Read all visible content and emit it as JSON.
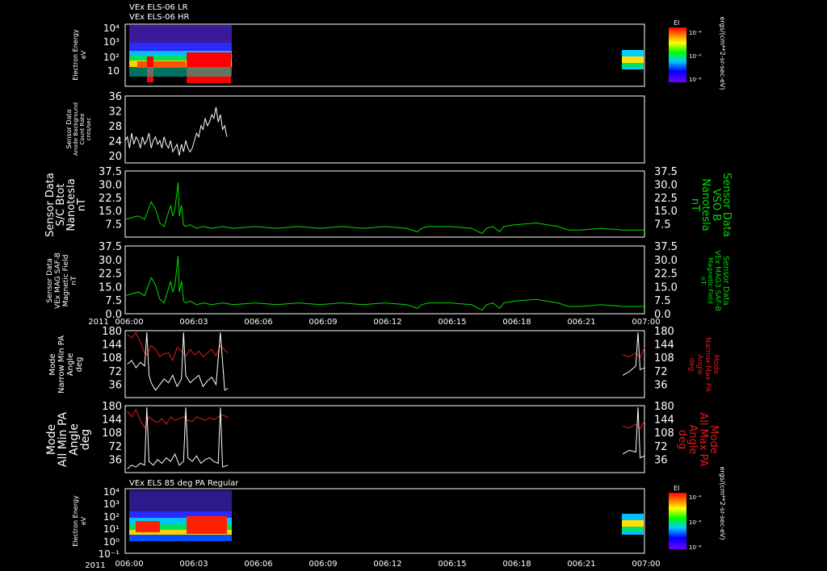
{
  "titles": {
    "top_line1": "VEx ELS-06 LR",
    "top_line2": "VEx ELS-06 HR",
    "bottom": "VEx ELS 85 deg PA Regular"
  },
  "time_axis": {
    "year_label": "2011",
    "ticks": [
      "006:00",
      "006:03",
      "006:06",
      "006:09",
      "006:12",
      "006:15",
      "006:18",
      "006:21",
      "007:00"
    ]
  },
  "colorbars": {
    "top": {
      "label": "EI",
      "ticks": [
        "10⁻⁴",
        "10⁻⁶",
        "10⁻⁸"
      ],
      "side_label": "ergs/(cm**2-sr-sec-eV)"
    },
    "bottom": {
      "label": "EI",
      "ticks": [
        "10⁻⁴",
        "10⁻⁶",
        "10⁻⁸"
      ],
      "side_label": "ergs/(cm**2-sr-sec-eV)"
    }
  },
  "colors": {
    "green": "#00dd00",
    "red": "#e41a1a",
    "white": "#ffffff"
  },
  "chart_data": [
    {
      "type": "heatmap",
      "ylabel": [
        "Electron Energy",
        "eV"
      ],
      "y_tick_labels": [
        "10⁴",
        "10³",
        "10²",
        "10"
      ],
      "log_scale": true
    },
    {
      "type": "line",
      "ylabel": [
        "Sensor Data",
        "Anode Background",
        "Count Rate",
        "cnts/sec"
      ],
      "ylim": [
        18,
        36
      ],
      "y_tick_labels": [
        "36",
        "32",
        "28",
        "24",
        "20"
      ],
      "series": [
        {
          "color": "white",
          "x": [
            0,
            0.1,
            0.2,
            0.3,
            0.4,
            0.5,
            0.6,
            0.7,
            0.8,
            0.9,
            1.0,
            1.1,
            1.2,
            1.3,
            1.4,
            1.5,
            1.6,
            1.7,
            1.8,
            1.9,
            2.0,
            2.1,
            2.2,
            2.3,
            2.4,
            2.5,
            2.6,
            2.7,
            2.8,
            2.9,
            3.0,
            3.1,
            3.2,
            3.3,
            3.4,
            3.5,
            3.6,
            3.7,
            3.8,
            3.9,
            4.0,
            4.1,
            4.2,
            4.3,
            4.4,
            4.5,
            4.6,
            4.7
          ],
          "values": [
            24,
            25,
            22,
            26,
            23,
            25,
            24,
            22,
            25,
            23,
            24,
            26,
            22,
            24,
            25,
            23,
            24,
            22,
            25,
            23,
            22,
            24,
            21,
            22,
            23,
            20,
            23,
            21,
            24,
            22,
            21,
            22,
            24,
            26,
            25,
            28,
            27,
            30,
            28,
            29,
            31,
            30,
            33,
            29,
            31,
            27,
            28,
            25
          ]
        }
      ]
    },
    {
      "type": "line",
      "ylabel": [
        "Sensor Data",
        "S/C Btot",
        "Nanotesla",
        "nT"
      ],
      "right_label": [
        "Sensor Data",
        "VSO B",
        "Nanotesla",
        "nT"
      ],
      "ylim": [
        0,
        37.5
      ],
      "y_tick_labels": [
        "37.5",
        "30.0",
        "22.5",
        "15.0",
        "7.5"
      ],
      "series": [
        {
          "color": "green",
          "x": [
            0,
            0.3,
            0.6,
            0.9,
            1.2,
            1.4,
            1.6,
            1.8,
            2.0,
            2.1,
            2.2,
            2.3,
            2.45,
            2.5,
            2.6,
            2.7,
            2.8,
            3.0,
            3.3,
            3.6,
            4.0,
            4.5,
            5,
            6,
            7,
            8,
            9,
            10,
            11,
            12,
            13,
            13.5,
            13.7,
            14,
            15,
            16,
            16.5,
            16.7,
            17,
            17.3,
            17.5,
            18,
            19,
            20,
            20.5,
            21,
            22,
            23,
            24
          ],
          "values": [
            10,
            11,
            12,
            10,
            20,
            16,
            8,
            6,
            14,
            18,
            12,
            16,
            31,
            12,
            18,
            7,
            6,
            7,
            5,
            6,
            5,
            6,
            5,
            6,
            5,
            6,
            5,
            6,
            5,
            6,
            5,
            3,
            5,
            6,
            6,
            5,
            2,
            5,
            6,
            3,
            6,
            7,
            8,
            6,
            4,
            4,
            5,
            4,
            4
          ]
        }
      ]
    },
    {
      "type": "line",
      "ylabel": [
        "Sensor Data",
        "VEx MAG SAF-B",
        "Magnetic Field",
        "nT"
      ],
      "right_label": [
        "Sensor Data",
        "VEx MAG3 SAF-B",
        "Magnetic Field",
        "nT"
      ],
      "ylim": [
        0,
        37.5
      ],
      "y_tick_labels": [
        "37.5",
        "30.0",
        "22.5",
        "15.0",
        "7.5",
        "0.0"
      ],
      "series": [
        {
          "color": "green",
          "x": [
            0,
            0.3,
            0.6,
            0.9,
            1.2,
            1.4,
            1.6,
            1.8,
            2.0,
            2.1,
            2.2,
            2.3,
            2.45,
            2.5,
            2.6,
            2.7,
            2.8,
            3.0,
            3.3,
            3.6,
            4.0,
            4.5,
            5,
            6,
            7,
            8,
            9,
            10,
            11,
            12,
            13,
            13.5,
            13.7,
            14,
            15,
            16,
            16.5,
            16.7,
            17,
            17.3,
            17.5,
            18,
            19,
            20,
            20.5,
            21,
            22,
            23,
            24
          ],
          "values": [
            10,
            11,
            12,
            10,
            20,
            16,
            8,
            6,
            14,
            18,
            12,
            16,
            32,
            12,
            18,
            7,
            6,
            7,
            5,
            6,
            5,
            6,
            5,
            6,
            5,
            6,
            5,
            6,
            5,
            6,
            5,
            3,
            5,
            6,
            6,
            5,
            2,
            5,
            6,
            3,
            6,
            7,
            8,
            6,
            4,
            4,
            5,
            4,
            4
          ]
        }
      ]
    },
    {
      "type": "line",
      "ylabel": [
        "Mode",
        "Narrow Min PA",
        "Angle",
        "deg"
      ],
      "right_label": [
        "Mode",
        "Narrow Max PA",
        "Angle",
        "deg"
      ],
      "ylim": [
        0,
        180
      ],
      "y_tick_labels": [
        "180",
        "144",
        "108",
        "72",
        "36"
      ],
      "series": [
        {
          "color": "red",
          "segments": [
            {
              "x": [
                0.1,
                0.3,
                0.5,
                0.7,
                0.9,
                1.0,
                1.2,
                1.4,
                1.6,
                1.8,
                2.0,
                2.2,
                2.4,
                2.6,
                2.8,
                3.0,
                3.2,
                3.4,
                3.6,
                3.8,
                4.0,
                4.2,
                4.4,
                4.6,
                4.75
              ],
              "values": [
                170,
                160,
                175,
                150,
                120,
                115,
                140,
                130,
                110,
                118,
                120,
                100,
                135,
                125,
                112,
                130,
                115,
                125,
                110,
                120,
                130,
                112,
                140,
                128,
                120
              ]
            },
            {
              "x": [
                23.0,
                23.3,
                23.6,
                23.8,
                24.0
              ],
              "values": [
                115,
                110,
                120,
                108,
                135
              ]
            }
          ]
        },
        {
          "color": "white",
          "segments": [
            {
              "x": [
                0.1,
                0.3,
                0.5,
                0.7,
                0.9,
                1.0,
                1.1,
                1.2,
                1.4,
                1.6,
                1.8,
                2.0,
                2.2,
                2.4,
                2.6,
                2.7,
                2.8,
                3.0,
                3.2,
                3.4,
                3.6,
                3.8,
                4.0,
                4.2,
                4.4,
                4.6,
                4.75
              ],
              "values": [
                90,
                100,
                80,
                95,
                85,
                175,
                60,
                40,
                20,
                35,
                50,
                40,
                60,
                30,
                50,
                175,
                60,
                40,
                50,
                60,
                30,
                45,
                55,
                35,
                175,
                20,
                25
              ]
            },
            {
              "x": [
                23.0,
                23.3,
                23.6,
                23.7,
                23.8,
                24.0
              ],
              "values": [
                60,
                70,
                85,
                175,
                75,
                80
              ]
            }
          ]
        }
      ]
    },
    {
      "type": "line",
      "ylabel": [
        "Mode",
        "All Min PA",
        "Angle",
        "deg"
      ],
      "right_label": [
        "Mode",
        "All Max PA",
        "Angle",
        "deg"
      ],
      "ylim": [
        0,
        180
      ],
      "y_tick_labels": [
        "180",
        "144",
        "108",
        "72",
        "36"
      ],
      "series": [
        {
          "color": "red",
          "segments": [
            {
              "x": [
                0.1,
                0.3,
                0.5,
                0.7,
                0.9,
                1.1,
                1.3,
                1.5,
                1.7,
                1.9,
                2.1,
                2.3,
                2.5,
                2.7,
                2.9,
                3.1,
                3.3,
                3.5,
                3.7,
                3.9,
                4.1,
                4.3,
                4.5,
                4.75
              ],
              "values": [
                165,
                150,
                170,
                140,
                120,
                150,
                140,
                135,
                145,
                130,
                150,
                140,
                145,
                150,
                140,
                138,
                150,
                145,
                140,
                148,
                142,
                150,
                155,
                148
              ]
            },
            {
              "x": [
                23.0,
                23.3,
                23.6,
                23.8,
                24.0
              ],
              "values": [
                125,
                120,
                130,
                118,
                140
              ]
            }
          ]
        },
        {
          "color": "white",
          "segments": [
            {
              "x": [
                0.1,
                0.3,
                0.5,
                0.7,
                0.9,
                1.0,
                1.1,
                1.3,
                1.5,
                1.7,
                1.9,
                2.1,
                2.3,
                2.5,
                2.7,
                2.8,
                2.9,
                3.1,
                3.3,
                3.5,
                3.7,
                3.9,
                4.1,
                4.3,
                4.4,
                4.5,
                4.75
              ],
              "values": [
                10,
                20,
                15,
                25,
                20,
                175,
                30,
                20,
                35,
                25,
                40,
                30,
                50,
                20,
                30,
                175,
                40,
                30,
                45,
                25,
                35,
                40,
                30,
                25,
                175,
                15,
                20
              ]
            },
            {
              "x": [
                23.0,
                23.3,
                23.6,
                23.7,
                23.8,
                24.0
              ],
              "values": [
                50,
                60,
                55,
                175,
                40,
                45
              ]
            }
          ]
        }
      ]
    },
    {
      "type": "heatmap",
      "ylabel": [
        "Electron Energy",
        "eV"
      ],
      "y_tick_labels": [
        "10⁴",
        "10³",
        "10²",
        "10¹",
        "10⁰",
        "10⁻¹"
      ],
      "log_scale": true
    }
  ]
}
